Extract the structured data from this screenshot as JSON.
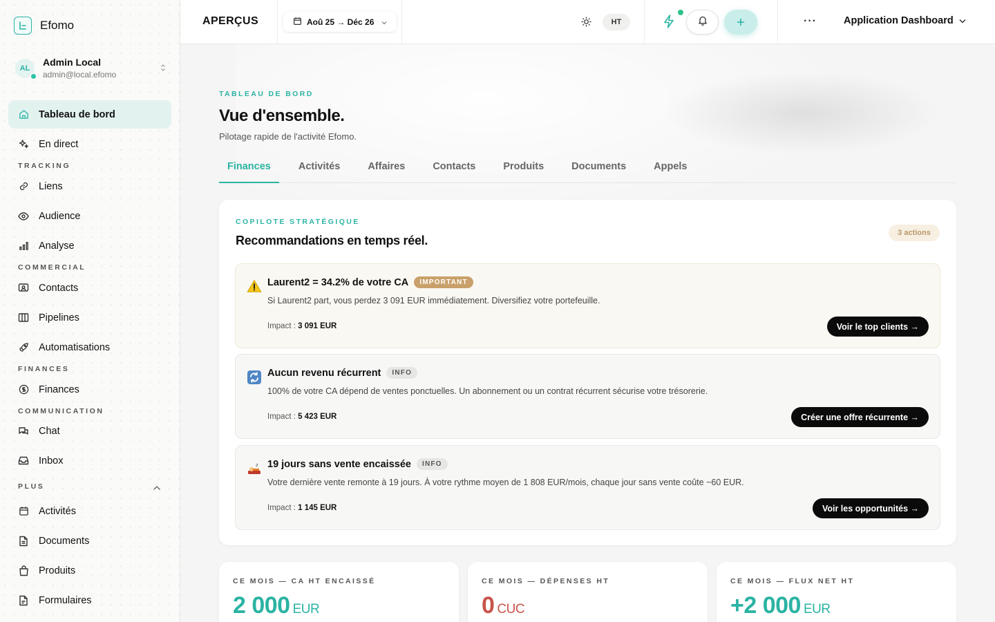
{
  "brand": {
    "name": "Efomo"
  },
  "user": {
    "initials": "AL",
    "name": "Admin Local",
    "email": "admin@local.efomo"
  },
  "sidebar": {
    "items": [
      {
        "label": "Tableau de bord"
      },
      {
        "label": "En direct"
      },
      {
        "label": "Liens"
      },
      {
        "label": "Audience"
      },
      {
        "label": "Analyse"
      },
      {
        "label": "Contacts"
      },
      {
        "label": "Pipelines"
      },
      {
        "label": "Automatisations"
      },
      {
        "label": "Finances"
      },
      {
        "label": "Chat"
      },
      {
        "label": "Inbox"
      },
      {
        "label": "Activités"
      },
      {
        "label": "Documents"
      },
      {
        "label": "Produits"
      },
      {
        "label": "Formulaires"
      }
    ],
    "sections": [
      "TRACKING",
      "COMMERCIAL",
      "FINANCES",
      "COMMUNICATION",
      "PLUS"
    ]
  },
  "topbar": {
    "title": "APERÇUS",
    "date_range": "Aoû 25 → Déc 26",
    "tax_mode": "HT",
    "more": "···",
    "app_selector": "Application Dashboard"
  },
  "page": {
    "eyebrow": "TABLEAU DE BORD",
    "title": "Vue d'ensemble.",
    "subtitle": "Pilotage rapide de l'activité Efomo.",
    "tabs": [
      {
        "label": "Finances"
      },
      {
        "label": "Activités"
      },
      {
        "label": "Affaires"
      },
      {
        "label": "Contacts"
      },
      {
        "label": "Produits"
      },
      {
        "label": "Documents"
      },
      {
        "label": "Appels"
      }
    ]
  },
  "copilot": {
    "eyebrow": "COPILOTE STRATÉGIQUE",
    "title": "Recommandations en temps réel.",
    "badge": "3 actions",
    "impact_label": "Impact :",
    "recommendations": [
      {
        "icon": "warning-icon",
        "title": "Laurent2 = 34.2% de votre CA",
        "tag": "IMPORTANT",
        "description": "Si Laurent2 part, vous perdez 3 091 EUR immédiatement. Diversifiez votre portefeuille.",
        "impact": "3 091 EUR",
        "action": "Voir le top clients →"
      },
      {
        "icon": "recurring-icon",
        "title": "Aucun revenu récurrent",
        "tag": "INFO",
        "description": "100% de votre CA dépend de ventes ponctuelles. Un abonnement ou un contrat récurrent sécurise votre trésorerie.",
        "impact": "5 423 EUR",
        "action": "Créer une offre récurrente →"
      },
      {
        "icon": "sleep-icon",
        "title": "19 jours sans vente encaissée",
        "tag": "INFO",
        "description": "Votre dernière vente remonte à 19 jours. À votre rythme moyen de 1 808 EUR/mois, chaque jour sans vente coûte ~60 EUR.",
        "impact": "1 145 EUR",
        "action": "Voir les opportunités →"
      }
    ]
  },
  "kpis": [
    {
      "label": "CE MOIS — CA HT ENCAISSÉ",
      "value": "2 000",
      "unit": "EUR"
    },
    {
      "label": "CE MOIS — DÉPENSES HT",
      "value": "0",
      "unit": "CUC"
    },
    {
      "label": "CE MOIS — FLUX NET HT",
      "value": "+2 000",
      "unit": "EUR"
    }
  ],
  "colors": {
    "accent": "#2bb3a3",
    "negative": "#c8544a",
    "important": "#c9a06a"
  }
}
